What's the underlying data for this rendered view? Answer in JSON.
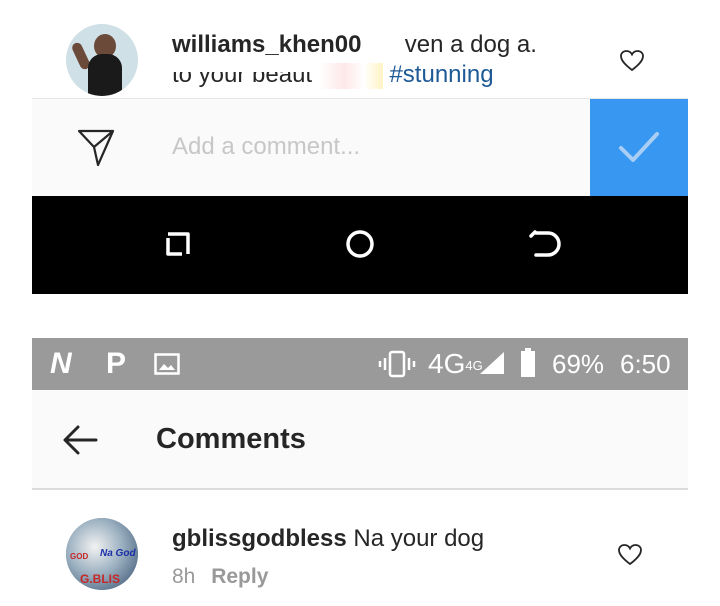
{
  "top_comment": {
    "username": "williams_khen00",
    "text_fragment": "ven a dog a.",
    "line2_fragment": "to your beaut",
    "hashtag": "#stunning",
    "avatar": "user-avatar",
    "like_icon": "heart-outline-icon"
  },
  "composer": {
    "placeholder": "Add a comment...",
    "value": "",
    "send_icon": "paper-plane-icon",
    "post_icon": "checkmark-icon",
    "post_color": "#3897f0"
  },
  "navbar": {
    "recent_icon": "recents-icon",
    "home_icon": "home-circle-icon",
    "back_icon": "back-arrow-icon"
  },
  "status_bar": {
    "app_icons": [
      "N",
      "P"
    ],
    "image_icon": "image-icon",
    "vibrate_icon": "vibrate-icon",
    "network": "4G",
    "network_super": "4G",
    "signal_icon": "signal-icon",
    "battery_icon": "battery-icon",
    "battery_level": "69%",
    "time": "6:50"
  },
  "header": {
    "title": "Comments",
    "back_icon": "arrow-left-icon"
  },
  "comment": {
    "username": "gblissgodbless",
    "text": "Na your dog",
    "time": "8h",
    "reply_label": "Reply",
    "avatar_text_1": "Na God",
    "avatar_text_2": "G.BLIS",
    "avatar_text_3": "GOD",
    "like_icon": "heart-outline-icon"
  },
  "colors": {
    "accent": "#3897f0",
    "hashtag": "#1e5a96",
    "status_bar": "#9a9a9a",
    "navbar": "#000000"
  }
}
